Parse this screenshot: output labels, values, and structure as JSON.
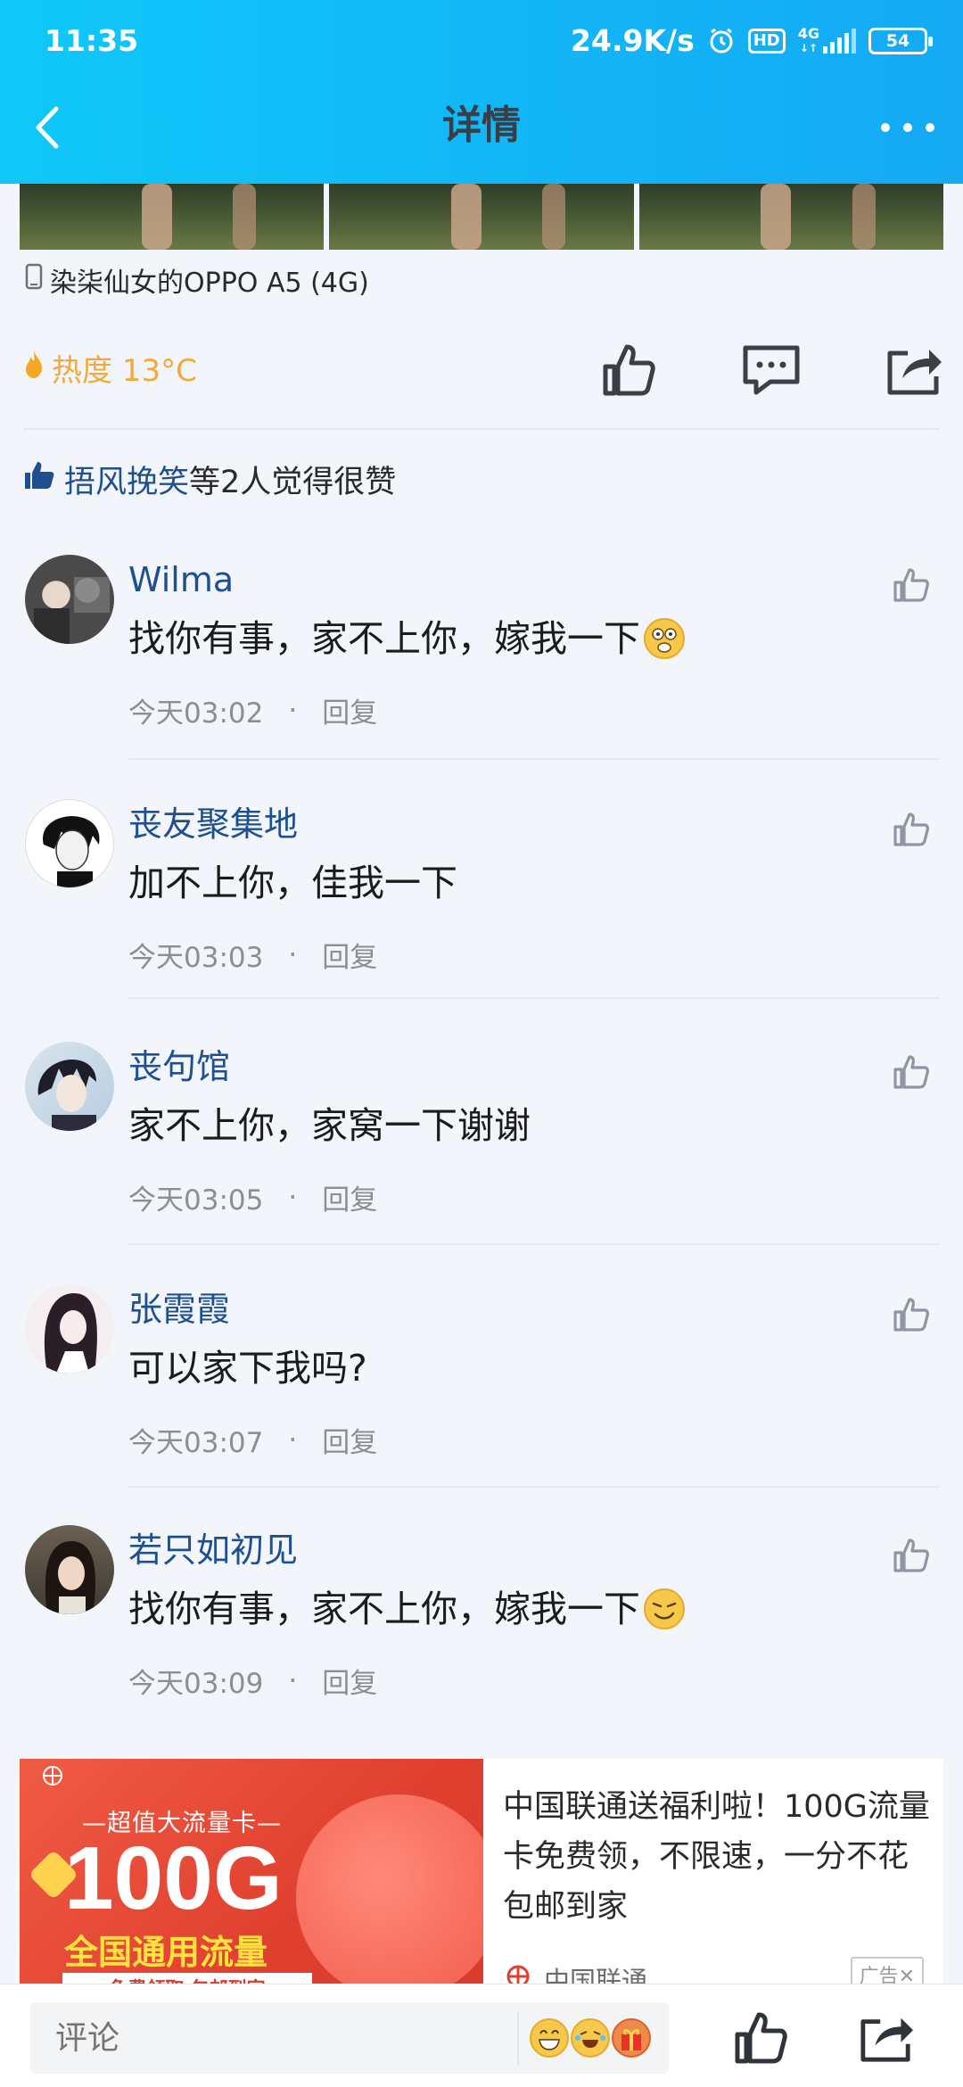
{
  "status_bar": {
    "time": "11:35",
    "net_speed": "24.9K/s",
    "hd": "HD",
    "network": "4G",
    "battery": "54"
  },
  "nav": {
    "title": "详情"
  },
  "device": "染柒仙女的OPPO A5 (4G)",
  "heat": "热度 13°C",
  "likes": {
    "names": "捂风挽笑",
    "suffix": "等2人觉得很赞"
  },
  "comments": [
    {
      "name": "Wilma",
      "text": "找你有事，家不上你，嫁我一下",
      "time": "今天03:02",
      "reply": "回复"
    },
    {
      "name": "丧友聚集地",
      "text": "加不上你，佳我一下",
      "time": "今天03:03",
      "reply": "回复"
    },
    {
      "name": "丧句馆",
      "text": "家不上你，家窝一下谢谢",
      "time": "今天03:05",
      "reply": "回复"
    },
    {
      "name": "张霞霞",
      "text": "可以家下我吗?",
      "time": "今天03:07",
      "reply": "回复"
    },
    {
      "name": "若只如初见",
      "text": "找你有事，家不上你，嫁我一下",
      "time": "今天03:09",
      "reply": "回复"
    }
  ],
  "ad": {
    "tag": "—超值大流量卡—",
    "big": "100G",
    "yellow": "全国通用流量",
    "bar": "免费领取 包邮到家",
    "text": "中国联通送福利啦！100G流量卡免费领，不限速，一分不花包邮到家",
    "brand": "中国联通",
    "badge": "广告✕"
  },
  "bottom": {
    "placeholder": "评论"
  },
  "colors": {
    "header_start": "#0fc8f8",
    "header_end": "#15a9f4",
    "name_blue": "#1f4f8f",
    "heat_orange": "#f2a93b",
    "ad_red": "#e0402f"
  }
}
